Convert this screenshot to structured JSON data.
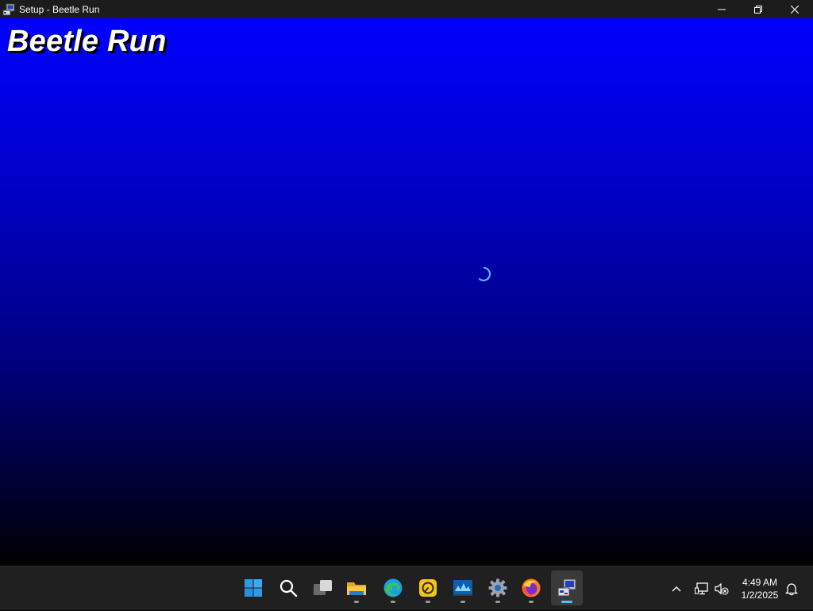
{
  "window": {
    "title": "Setup - Beetle Run",
    "icon": "setup-app-icon",
    "controls": [
      "minimize-icon",
      "restore-icon",
      "close-icon"
    ]
  },
  "content": {
    "game_title": "Beetle Run",
    "background_gradient": [
      "#0000ff",
      "#000000"
    ],
    "loading_indicator": "spinner-icon",
    "spinner_color": "#5ab4ff"
  },
  "taskbar": {
    "apps": [
      {
        "name": "start-icon",
        "running": false
      },
      {
        "name": "search-icon",
        "running": false
      },
      {
        "name": "task-view-icon",
        "running": false
      },
      {
        "name": "file-explorer-icon",
        "running": true
      },
      {
        "name": "edge-icon",
        "running": true
      },
      {
        "name": "app-yellow-icon",
        "running": true
      },
      {
        "name": "monitor-app-icon",
        "running": true
      },
      {
        "name": "settings-icon",
        "running": true
      },
      {
        "name": "firefox-icon",
        "running": true
      },
      {
        "name": "setup-app-icon",
        "running": true,
        "active": true
      }
    ],
    "tray": [
      "chevron-up-icon",
      "network-icon",
      "volume-muted-icon",
      "notification-bell-icon"
    ],
    "clock": {
      "time": "4:49 AM",
      "date": "1/2/2025"
    },
    "accent": "#4cc2ff"
  }
}
